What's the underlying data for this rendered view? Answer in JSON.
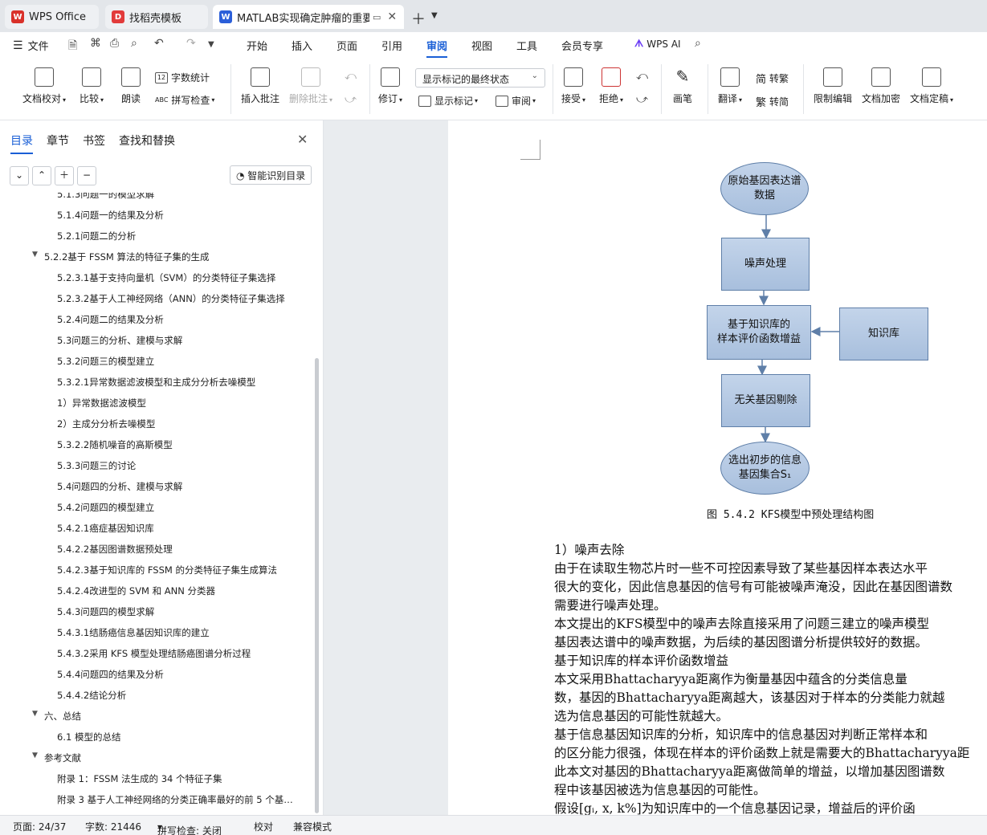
{
  "tabs": [
    {
      "label": "WPS Office",
      "icon": "wps-logo-icon",
      "color": "#d9312a",
      "active": false
    },
    {
      "label": "找稻壳模板",
      "icon": "docer-icon",
      "color": "#e23b3b",
      "active": false
    },
    {
      "label": "MATLAB实现确定肿瘤的重要",
      "icon": "word-doc-icon",
      "color": "#2b5fd9",
      "active": true
    }
  ],
  "menu": {
    "file": "文件",
    "items": [
      "开始",
      "插入",
      "页面",
      "引用",
      "审阅",
      "视图",
      "工具",
      "会员专享"
    ],
    "active": "审阅",
    "ai": "WPS AI"
  },
  "ribbon": {
    "doc_check": "文档校对",
    "compare": "比较",
    "read_aloud": "朗读",
    "word_count": "字数统计",
    "spell_check": "拼写检查",
    "insert_comment": "插入批注",
    "delete_comment": "删除批注",
    "track_changes": "修订",
    "markup_view": "显示标记的最终状态",
    "show_markup": "显示标记",
    "review": "审阅",
    "accept": "接受",
    "reject": "拒绝",
    "pen": "画笔",
    "translate": "翻译",
    "to_traditional": "转繁",
    "to_simplified": "转简",
    "restrict_edit": "限制编辑",
    "encrypt": "文档加密",
    "finalize": "文档定稿"
  },
  "sidebar": {
    "tabs": [
      "目录",
      "章节",
      "书签",
      "查找和替换"
    ],
    "smart_toc": "智能识别目录",
    "toc": [
      {
        "text": "5.1.3问题一的模型求解",
        "level": 3
      },
      {
        "text": "5.1.4问题一的结果及分析",
        "level": 3
      },
      {
        "text": "5.2.1问题二的分析",
        "level": 3
      },
      {
        "text": "5.2.2基于 FSSM 算法的特征子集的生成",
        "level": 2,
        "expanded": true
      },
      {
        "text": "5.2.3.1基于支持向量机（SVM）的分类特征子集选择",
        "level": 3
      },
      {
        "text": "5.2.3.2基于人工神经网络（ANN）的分类特征子集选择",
        "level": 3
      },
      {
        "text": "5.2.4问题二的结果及分析",
        "level": 3
      },
      {
        "text": "5.3问题三的分析、建模与求解",
        "level": 3
      },
      {
        "text": "5.3.2问题三的模型建立",
        "level": 3
      },
      {
        "text": "5.3.2.1异常数据滤波模型和主成分分析去噪模型",
        "level": 3
      },
      {
        "text": "1）异常数据滤波模型",
        "level": 3
      },
      {
        "text": "2）主成分分析去噪模型",
        "level": 3
      },
      {
        "text": "5.3.2.2随机噪音的高斯模型",
        "level": 3
      },
      {
        "text": "5.3.3问题三的讨论",
        "level": 3
      },
      {
        "text": "5.4问题四的分析、建模与求解",
        "level": 3
      },
      {
        "text": "5.4.2问题四的模型建立",
        "level": 3
      },
      {
        "text": "5.4.2.1癌症基因知识库",
        "level": 3
      },
      {
        "text": "5.4.2.2基因图谱数据预处理",
        "level": 3
      },
      {
        "text": "5.4.2.3基于知识库的 FSSM 的分类特征子集生成算法",
        "level": 3
      },
      {
        "text": "5.4.2.4改进型的 SVM 和 ANN 分类器",
        "level": 3
      },
      {
        "text": "5.4.3问题四的模型求解",
        "level": 3
      },
      {
        "text": "5.4.3.1结肠癌信息基因知识库的建立",
        "level": 3
      },
      {
        "text": "5.4.3.2采用 KFS 模型处理结肠癌图谱分析过程",
        "level": 3
      },
      {
        "text": "5.4.4问题四的结果及分析",
        "level": 3
      },
      {
        "text": "5.4.4.2结论分析",
        "level": 3
      },
      {
        "text": "六、总结",
        "level": 2,
        "expanded": true
      },
      {
        "text": "6.1 模型的总结",
        "level": 3
      },
      {
        "text": "参考文献",
        "level": 2,
        "expanded": true
      },
      {
        "text": "附录 1：FSSM 法生成的 34 个特征子集",
        "level": 3
      },
      {
        "text": "附录 3 基于人工神经网络的分类正确率最好的前 5 个基…",
        "level": 3
      }
    ]
  },
  "flowchart": {
    "start": "原始基因表达谱\n数据",
    "noise": "噪声处理",
    "gain": "基于知识库的\n样本评价函数增益",
    "kb": "知识库",
    "remove": "无关基因剔除",
    "end": "选出初步的信息\n基因集合S₁",
    "caption": "图 5.4.2 KFS模型中预处理结构图"
  },
  "document": {
    "lines": [
      "1）噪声去除",
      "    由于在读取生物芯片时一些不可控因素导致了某些基因样本表达水平",
      "很大的变化，因此信息基因的信号有可能被噪声淹没，因此在基因图谱数",
      "需要进行噪声处理。",
      "    本文提出的KFS模型中的噪声去除直接采用了问题三建立的噪声模型",
      "基因表达谱中的噪声数据，为后续的基因图谱分析提供较好的数据。",
      "基于知识库的样本评价函数增益",
      "      本文采用Bhattacharyya距离作为衡量基因中蕴含的分类信息量",
      "数，基因的Bhattacharyya距离越大，该基因对于样本的分类能力就越",
      "选为信息基因的可能性就越大。",
      "      基于信息基因知识库的分析，知识库中的信息基因对判断正常样本和",
      "的区分能力很强，体现在样本的评价函数上就是需要大的Bhattacharyya距",
      "此本文对基因的Bhattacharyya距离做简单的增益，以增加基因图谱数",
      "程中该基因被选为信息基因的可能性。",
      "      假设[gᵢ, x, k%]为知识库中的一个信息基因记录，增益后的评价函"
    ]
  },
  "status": {
    "page": "页面: 24/37",
    "words": "字数: 21446",
    "spell": "拼写检查: 关闭",
    "proof": "校对",
    "compat": "兼容模式"
  },
  "colors": {
    "accent": "#1a5fd6",
    "flow_fill": "#b3c7e2",
    "flow_border": "#5f7fa8"
  }
}
